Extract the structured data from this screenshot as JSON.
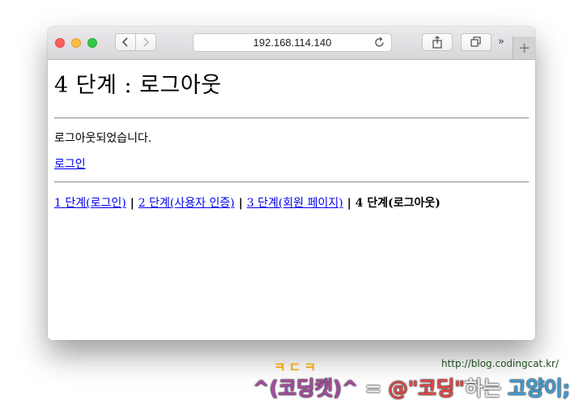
{
  "browser": {
    "address": "192.168.114.140",
    "more_glyph": "»",
    "new_tab_glyph": "+"
  },
  "page": {
    "title": "4 단계 : 로그아웃",
    "message": "로그아웃되었습니다.",
    "login_link": "로그인",
    "steps": [
      {
        "label": "1 단계(로그인)"
      },
      {
        "label": "2 단계(사용자 인증)"
      },
      {
        "label": "3 단계(회원 페이지)"
      },
      {
        "label": "4 단계(로그아웃)"
      }
    ],
    "separator": "|"
  },
  "watermark": {
    "url": "http://blog.codingcat.kr/",
    "small": "ㅋㄷㅋ",
    "part1": "^(코딩캣)^",
    "part2": " = ",
    "part3": "@\"코딩\"",
    "part4": "하는 ",
    "part5": "고양이;"
  }
}
